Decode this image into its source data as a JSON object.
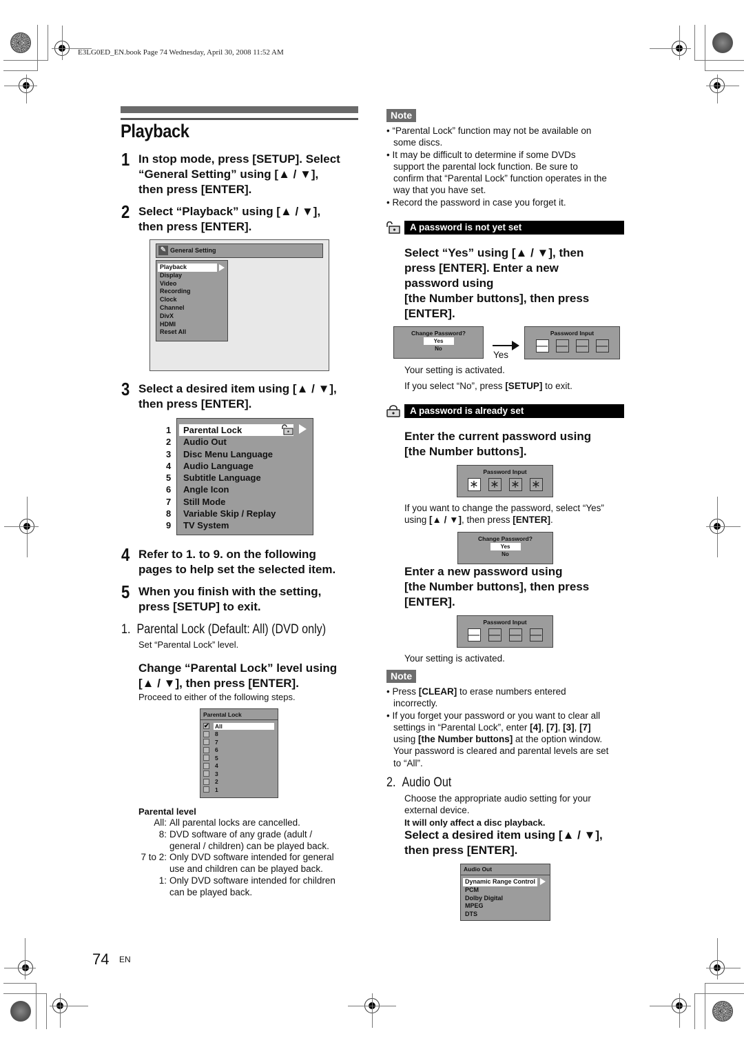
{
  "header": {
    "file_info": "E3LG0ED_EN.book  Page 74  Wednesday, April 30, 2008  11:52 AM"
  },
  "page": {
    "title": "Playback",
    "number": "74",
    "lang": "EN"
  },
  "steps": [
    {
      "num": "1",
      "lines": [
        "In stop mode, press [SETUP]. Select",
        "“General Setting” using [▲ / ▼],",
        "then press [ENTER]."
      ]
    },
    {
      "num": "2",
      "lines": [
        "Select “Playback” using [▲ / ▼],",
        "then press [ENTER]."
      ]
    },
    {
      "num": "3",
      "lines": [
        "Select a desired item using [▲ / ▼],",
        "then press [ENTER]."
      ]
    },
    {
      "num": "4",
      "lines": [
        "Refer to 1. to 9. on the following",
        "pages to help set the selected item."
      ]
    },
    {
      "num": "5",
      "lines": [
        "When you finish with the setting,",
        "press [SETUP] to exit."
      ]
    }
  ],
  "general_setting_menu": {
    "title": "General Setting",
    "icon": "wrench-icon",
    "items": [
      "Playback",
      "Display",
      "Video",
      "Recording",
      "Clock",
      "Channel",
      "DivX",
      "HDMI",
      "Reset All"
    ],
    "selected": "Playback"
  },
  "playback_menu": {
    "numbers": [
      "1",
      "2",
      "3",
      "4",
      "5",
      "6",
      "7",
      "8",
      "9"
    ],
    "items": [
      "Parental Lock",
      "Audio Out",
      "Disc Menu Language",
      "Audio Language",
      "Subtitle Language",
      "Angle Icon",
      "Still Mode",
      "Variable Skip / Replay",
      "TV System"
    ],
    "selected": "Parental Lock",
    "selected_icon": "lock-open-icon"
  },
  "parental_lock": {
    "heading_num": "1.",
    "heading": "Parental Lock (Default: All) (DVD only)",
    "description": "Set “Parental Lock” level.",
    "instruction_lines": [
      "Change “Parental Lock” level using",
      "[▲ / ▼], then press [ENTER]."
    ],
    "proceed": "Proceed to either of the following steps.",
    "menu": {
      "title": "Parental Lock",
      "items": [
        "All",
        "8",
        "7",
        "6",
        "5",
        "4",
        "3",
        "2",
        "1"
      ],
      "checked": "All"
    },
    "levels_title": "Parental level",
    "levels": [
      {
        "key": "All:",
        "lines": [
          "All parental locks are cancelled."
        ]
      },
      {
        "key": "8:",
        "lines": [
          "DVD software of any grade (adult /",
          "general / children) can be played back."
        ]
      },
      {
        "key": "7 to 2:",
        "lines": [
          "Only DVD software intended for general",
          "use and children can be played back."
        ]
      },
      {
        "key": "1:",
        "lines": [
          "Only DVD software intended for children",
          "can be played back."
        ]
      }
    ]
  },
  "note1": {
    "label": "Note",
    "bullets": [
      [
        "“Parental Lock” function may not be available on",
        "some discs."
      ],
      [
        "It may be difficult to determine if some DVDs",
        "support the parental lock function. Be sure to",
        "confirm that “Parental Lock” function operates in the",
        "way that you have set."
      ],
      [
        "Record the password in case you forget it."
      ]
    ]
  },
  "not_yet_set": {
    "bar": "A password is not yet set",
    "instruction_lines": [
      "Select “Yes” using [▲ / ▼], then",
      "press [ENTER]. Enter a new",
      "password using",
      "[the Number buttons], then press",
      "[ENTER]."
    ],
    "change_box": {
      "title": "Change Password?",
      "yes": "Yes",
      "no": "No"
    },
    "arrow_label": "Yes",
    "password_box": {
      "title": "Password Input",
      "cells": [
        "—",
        "—",
        "—",
        "—"
      ]
    },
    "activated": "Your setting is activated.",
    "no_text_pre": "If you select “No”, press ",
    "no_text_key": "[SETUP]",
    "no_text_post": " to exit."
  },
  "already_set": {
    "bar": "A password is already set",
    "instruction_lines": [
      "Enter the current password using",
      "[the Number buttons]."
    ],
    "password_box": {
      "title": "Password Input",
      "cells": [
        "∗",
        "∗",
        "∗",
        "∗"
      ]
    },
    "change_text_line1": "If you want to change the password, select “Yes”",
    "change_text_pre": "using ",
    "change_text_key1": "[▲ / ▼]",
    "change_text_mid": ", then press ",
    "change_text_key2": "[ENTER]",
    "change_text_post": ".",
    "change_box": {
      "title": "Change Password?",
      "yes": "Yes",
      "no": "No"
    },
    "new_instruction_lines": [
      "Enter a new password using",
      "[the Number buttons], then press",
      "[ENTER]."
    ],
    "new_password_box": {
      "title": "Password Input",
      "cells": [
        "—",
        "—",
        "—",
        "—"
      ]
    },
    "activated": "Your setting is activated."
  },
  "note2": {
    "label": "Note",
    "b1_pre": "Press ",
    "b1_key": "[CLEAR]",
    "b1_post": " to erase numbers entered",
    "b1_line2": "incorrectly.",
    "b2_line1": "If you forget your password or you want to clear all",
    "b2_pre": "settings in “Parental Lock”, enter ",
    "b2_k1": "[4]",
    "b2_k2": "[7]",
    "b2_k3": "[3]",
    "b2_k4": "[7]",
    "b2_sep": ", ",
    "b2_l3_pre": "using ",
    "b2_l3_key": "[the Number buttons]",
    "b2_l3_post": " at the option window.",
    "b2_line4": "Your password is cleared and parental levels are set",
    "b2_line5": "to “All”."
  },
  "audio_out": {
    "heading_num": "2.",
    "heading": "Audio Out",
    "desc_lines": [
      "Choose the appropriate audio setting for your",
      "external device."
    ],
    "bold_note": "It will only affect a disc playback.",
    "instruction_lines": [
      "Select a desired item using [▲ / ▼],",
      "then press [ENTER]."
    ],
    "menu": {
      "title": "Audio Out",
      "items": [
        "Dynamic Range Control",
        "PCM",
        "Dolby Digital",
        "MPEG",
        "DTS"
      ],
      "selected": "Dynamic Range Control"
    }
  }
}
